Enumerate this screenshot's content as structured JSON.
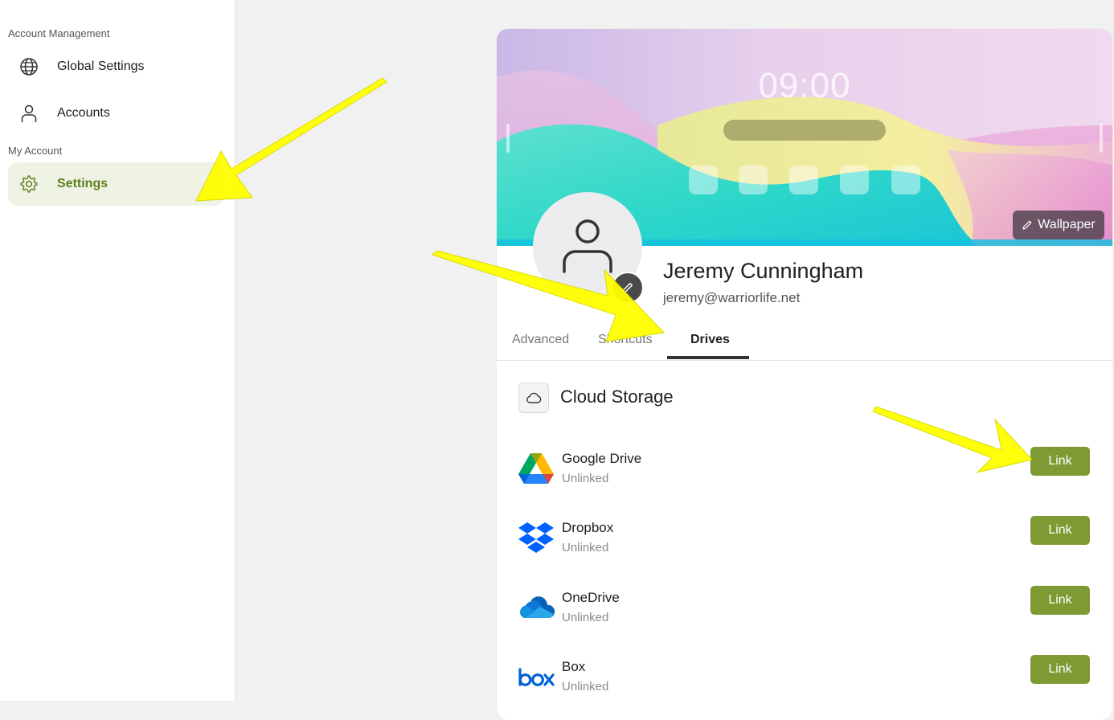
{
  "sidebar": {
    "sections": [
      {
        "label": "Account Management"
      },
      {
        "label": "My Account"
      }
    ],
    "items": [
      {
        "label": "Global Settings",
        "icon": "globe-icon"
      },
      {
        "label": "Accounts",
        "icon": "person-icon"
      },
      {
        "label": "Settings",
        "icon": "gear-icon",
        "active": true
      }
    ]
  },
  "profile": {
    "clock": "09:00",
    "wallpaper_button": "Wallpaper",
    "name": "Jeremy Cunningham",
    "email": "jeremy@warriorlife.net",
    "tabs": [
      {
        "label": "Advanced"
      },
      {
        "label": "Shortcuts"
      },
      {
        "label": "Drives",
        "active": true
      }
    ]
  },
  "cloud_storage": {
    "title": "Cloud Storage",
    "icon": "cloud-icon",
    "drives": [
      {
        "name": "Google Drive",
        "status": "Unlinked",
        "button": "Link",
        "icon": "google-drive-icon"
      },
      {
        "name": "Dropbox",
        "status": "Unlinked",
        "button": "Link",
        "icon": "dropbox-icon"
      },
      {
        "name": "OneDrive",
        "status": "Unlinked",
        "button": "Link",
        "icon": "onedrive-icon"
      },
      {
        "name": "Box",
        "status": "Unlinked",
        "button": "Link",
        "icon": "box-icon"
      }
    ]
  },
  "colors": {
    "accent": "#7d9a33",
    "active_nav_bg": "#eef3e4",
    "annotation_arrow": "#ffff00"
  }
}
